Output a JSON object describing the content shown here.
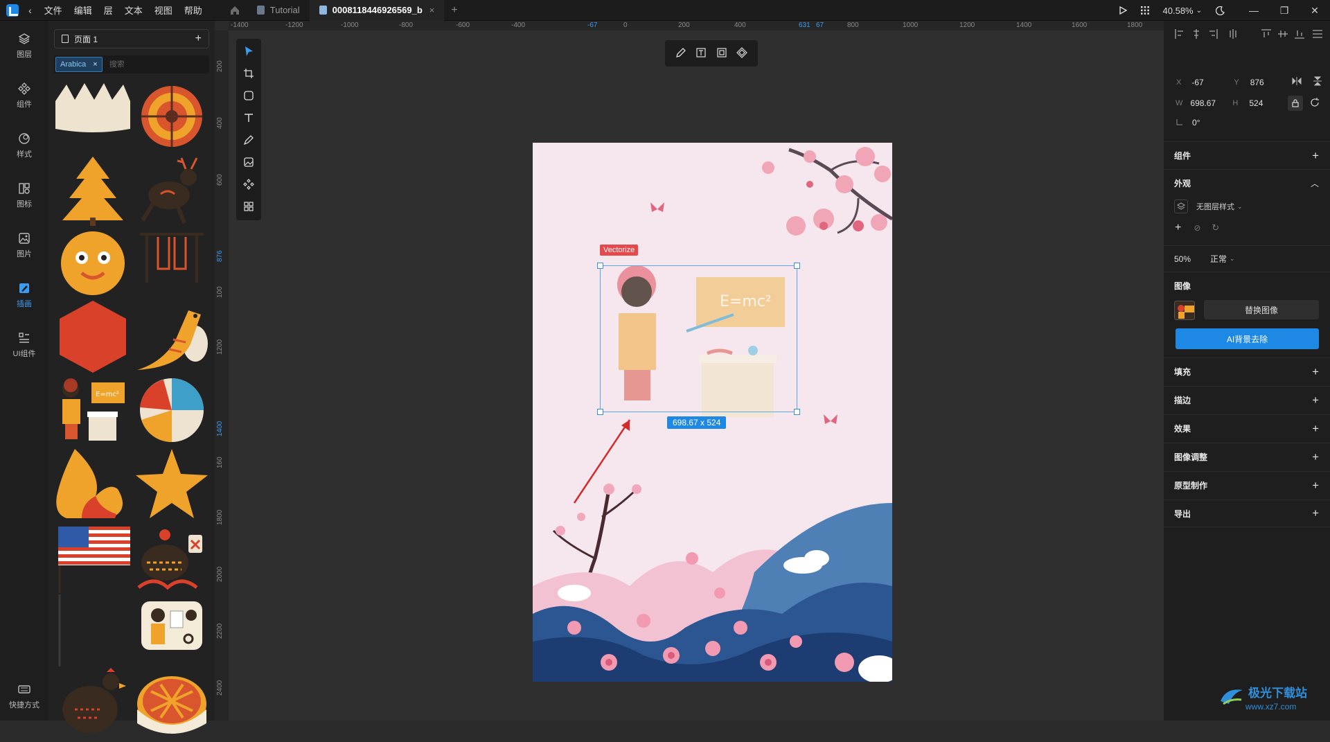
{
  "menu": [
    "文件",
    "编辑",
    "层",
    "文本",
    "视图",
    "帮助"
  ],
  "tabs": [
    {
      "label": "Tutorial"
    },
    {
      "label": "0008118446926569_b",
      "close": "×"
    }
  ],
  "tab_add": "+",
  "topbar": {
    "zoom": "40.58%"
  },
  "rail": [
    {
      "label": "图层",
      "icon": "layers-icon"
    },
    {
      "label": "组件",
      "icon": "components-icon"
    },
    {
      "label": "样式",
      "icon": "styles-icon"
    },
    {
      "label": "图标",
      "icon": "icons-icon"
    },
    {
      "label": "图片",
      "icon": "images-icon"
    },
    {
      "label": "插画",
      "icon": "illustrations-icon"
    },
    {
      "label": "UI组件",
      "icon": "ui-kit-icon"
    },
    {
      "label": "快捷方式",
      "icon": "keyboard-icon"
    }
  ],
  "assets": {
    "page_name": "页面 1",
    "page_add": "+",
    "filter_chip": "Arabica",
    "chip_close": "×",
    "search_placeholder": "搜索"
  },
  "ruler_top": [
    "-1400",
    "-1200",
    "-1000",
    "-800",
    "-600",
    "-400",
    "-67",
    "0",
    "200",
    "400",
    "631",
    "67",
    "800",
    "1000",
    "1200",
    "1400",
    "1600",
    "1800"
  ],
  "ruler_left": [
    "200",
    "400",
    "600",
    "876",
    "100",
    "1200",
    "1400",
    "160",
    "1800",
    "2000",
    "2200",
    "2400"
  ],
  "canvas": {
    "vectorize_badge": "Vectorize",
    "size_badge": "698.67 x 524",
    "chalkboard_text": "E=mc²"
  },
  "inspector": {
    "x_label": "X",
    "x_value": "-67",
    "y_label": "Y",
    "y_value": "876",
    "w_label": "W",
    "w_value": "698.67",
    "h_label": "H",
    "h_value": "524",
    "rotation": "0°",
    "sections": {
      "components": "组件",
      "appearance": "外观",
      "image": "图像",
      "fill": "填充",
      "stroke": "描边",
      "effects": "效果",
      "image_adjust": "图像调整",
      "prototype": "原型制作",
      "export": "导出"
    },
    "layer_style": "无图层样式",
    "opacity": "50%",
    "blend": "正常",
    "replace_image": "替换图像",
    "ai_remove_bg": "AI背景去除"
  },
  "watermark": {
    "text": "极光下载站",
    "url": "www.xz7.com"
  },
  "colors": {
    "accent": "#1e88e5",
    "danger": "#e5484d",
    "selection": "#58a9e6"
  }
}
